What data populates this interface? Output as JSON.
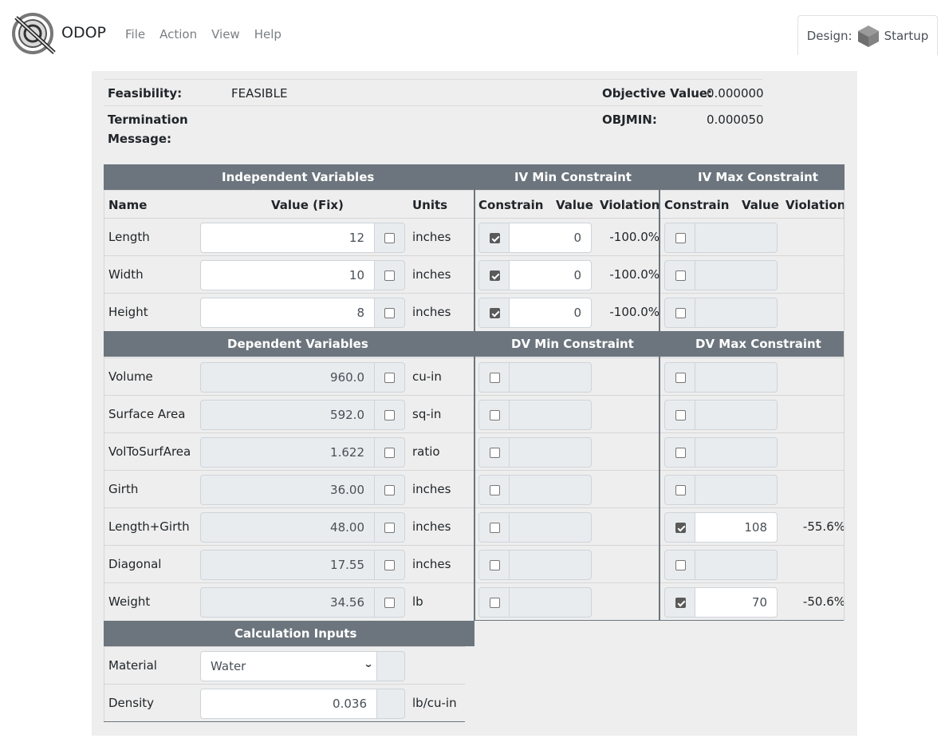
{
  "app": {
    "brand": "ODOP",
    "menu": [
      "File",
      "Action",
      "View",
      "Help"
    ],
    "design_label": "Design:",
    "design_name": "Startup"
  },
  "status": {
    "feasibility_label": "Feasibility:",
    "feasibility_value": "FEASIBLE",
    "termination_label_1": "Termination",
    "termination_label_2": "Message:",
    "termination_value": "",
    "objective_label": "Objective Value:",
    "objective_value": "0.000000",
    "objmin_label": "OBJMIN:",
    "objmin_value": "0.000050"
  },
  "headers": {
    "iv": "Independent Variables",
    "iv_min": "IV Min Constraint",
    "iv_max": "IV Max Constraint",
    "dv": "Dependent Variables",
    "dv_min": "DV Min Constraint",
    "dv_max": "DV Max Constraint",
    "calc": "Calculation Inputs"
  },
  "columns": {
    "name": "Name",
    "value_fix": "Value (Fix)",
    "units": "Units",
    "constrain": "Constrain",
    "value": "Value",
    "violation": "Violation"
  },
  "independent": [
    {
      "name": "Length",
      "value": "12",
      "fix": false,
      "units": "inches",
      "min": {
        "on": true,
        "value": "0",
        "violation": "-100.0%"
      },
      "max": {
        "on": false,
        "value": "",
        "violation": ""
      }
    },
    {
      "name": "Width",
      "value": "10",
      "fix": false,
      "units": "inches",
      "min": {
        "on": true,
        "value": "0",
        "violation": "-100.0%"
      },
      "max": {
        "on": false,
        "value": "",
        "violation": ""
      }
    },
    {
      "name": "Height",
      "value": "8",
      "fix": false,
      "units": "inches",
      "min": {
        "on": true,
        "value": "0",
        "violation": "-100.0%"
      },
      "max": {
        "on": false,
        "value": "",
        "violation": ""
      }
    }
  ],
  "dependent": [
    {
      "name": "Volume",
      "value": "960.0",
      "fix": false,
      "units": "cu-in",
      "min": {
        "on": false,
        "value": "",
        "violation": ""
      },
      "max": {
        "on": false,
        "value": "",
        "violation": ""
      }
    },
    {
      "name": "Surface Area",
      "value": "592.0",
      "fix": false,
      "units": "sq-in",
      "min": {
        "on": false,
        "value": "",
        "violation": ""
      },
      "max": {
        "on": false,
        "value": "",
        "violation": ""
      }
    },
    {
      "name": "VolToSurfArea",
      "value": "1.622",
      "fix": false,
      "units": "ratio",
      "min": {
        "on": false,
        "value": "",
        "violation": ""
      },
      "max": {
        "on": false,
        "value": "",
        "violation": ""
      }
    },
    {
      "name": "Girth",
      "value": "36.00",
      "fix": false,
      "units": "inches",
      "min": {
        "on": false,
        "value": "",
        "violation": ""
      },
      "max": {
        "on": false,
        "value": "",
        "violation": ""
      }
    },
    {
      "name": "Length+Girth",
      "value": "48.00",
      "fix": false,
      "units": "inches",
      "min": {
        "on": false,
        "value": "",
        "violation": ""
      },
      "max": {
        "on": true,
        "value": "108",
        "violation": "-55.6%"
      }
    },
    {
      "name": "Diagonal",
      "value": "17.55",
      "fix": false,
      "units": "inches",
      "min": {
        "on": false,
        "value": "",
        "violation": ""
      },
      "max": {
        "on": false,
        "value": "",
        "violation": ""
      }
    },
    {
      "name": "Weight",
      "value": "34.56",
      "fix": false,
      "units": "lb",
      "min": {
        "on": false,
        "value": "",
        "violation": ""
      },
      "max": {
        "on": true,
        "value": "70",
        "violation": "-50.6%"
      }
    }
  ],
  "calc_inputs": [
    {
      "name": "Material",
      "type": "select",
      "value": "Water",
      "units": ""
    },
    {
      "name": "Density",
      "type": "text",
      "value": "0.036",
      "units": "lb/cu-in"
    }
  ]
}
